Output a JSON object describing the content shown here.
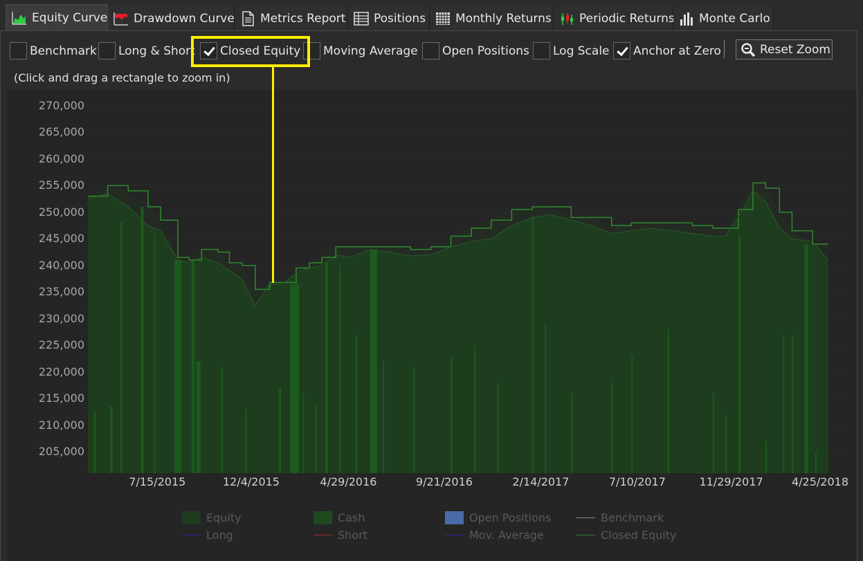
{
  "tabs": [
    {
      "label": "Equity Curve",
      "icon": "area-chart-icon",
      "active": true
    },
    {
      "label": "Drawdown Curve",
      "icon": "drawdown-chart-icon",
      "active": false
    },
    {
      "label": "Metrics Report",
      "icon": "document-icon",
      "active": false
    },
    {
      "label": "Positions",
      "icon": "table-icon",
      "active": false
    },
    {
      "label": "Monthly Returns",
      "icon": "grid-icon",
      "active": false
    },
    {
      "label": "Periodic Returns",
      "icon": "candlestick-icon",
      "active": false
    },
    {
      "label": "Monte Carlo",
      "icon": "histogram-icon",
      "active": false
    }
  ],
  "options": [
    {
      "label": "Benchmark",
      "checked": false
    },
    {
      "label": "Long & Short",
      "checked": false
    },
    {
      "label": "Closed Equity",
      "checked": true
    },
    {
      "label": "Moving Average",
      "checked": false
    },
    {
      "label": "Open Positions",
      "checked": false
    },
    {
      "label": "Log Scale",
      "checked": false
    },
    {
      "label": "Anchor at Zero",
      "checked": true
    }
  ],
  "reset_zoom_label": "Reset Zoom",
  "hint": "(Click and drag a rectangle to zoom in)",
  "colors": {
    "highlight": "#ffee00",
    "equity_fill": "#1e4a1e",
    "cash_fill": "#1a5a1a",
    "closed_equity_line": "#2e8b2e",
    "open_positions": "#4a6aa8",
    "benchmark": "#d0d0d0",
    "long": "#1a1a8a",
    "short": "#8a1a1a"
  },
  "chart_data": {
    "type": "area",
    "x_ticks": [
      "7/15/2015",
      "12/4/2015",
      "4/29/2016",
      "9/21/2016",
      "2/14/2017",
      "7/10/2017",
      "11/29/2017",
      "4/25/2018"
    ],
    "y_ticks": [
      "270,000",
      "265,000",
      "260,000",
      "255,000",
      "250,000",
      "245,000",
      "240,000",
      "235,000",
      "230,000",
      "225,000",
      "220,000",
      "215,000",
      "210,000",
      "205,000"
    ],
    "ylim": [
      201000,
      271000
    ],
    "xlim": [
      "2015-04-01",
      "2018-04-25"
    ],
    "series": [
      {
        "name": "Equity",
        "x": [
          "2015-04-01",
          "2015-05-01",
          "2015-06-01",
          "2015-07-01",
          "2015-07-20",
          "2015-08-15",
          "2015-09-01",
          "2015-09-20",
          "2015-10-15",
          "2015-11-01",
          "2015-11-20",
          "2015-12-10",
          "2016-01-01",
          "2016-01-20",
          "2016-02-10",
          "2016-03-01",
          "2016-03-20",
          "2016-04-10",
          "2016-05-01",
          "2016-06-01",
          "2016-07-01",
          "2016-08-01",
          "2016-09-01",
          "2016-10-01",
          "2016-11-01",
          "2016-12-01",
          "2017-01-01",
          "2017-02-01",
          "2017-03-01",
          "2017-04-01",
          "2017-05-01",
          "2017-06-01",
          "2017-07-01",
          "2017-08-01",
          "2017-09-01",
          "2017-10-01",
          "2017-11-01",
          "2017-11-20",
          "2017-12-10",
          "2018-01-01",
          "2018-01-20",
          "2018-02-10",
          "2018-03-01",
          "2018-04-01",
          "2018-04-25"
        ],
        "values": [
          252500,
          253500,
          251000,
          247500,
          246500,
          241000,
          240500,
          241500,
          240500,
          239000,
          237500,
          232500,
          236500,
          236500,
          238500,
          239500,
          240000,
          242000,
          241500,
          243000,
          242500,
          241800,
          242000,
          243500,
          244500,
          245000,
          247500,
          249000,
          249500,
          248500,
          247500,
          246000,
          246500,
          247000,
          246500,
          246000,
          245500,
          245500,
          249000,
          254000,
          252000,
          247000,
          245000,
          244500,
          241000
        ]
      },
      {
        "name": "Closed Equity",
        "x": [
          "2015-04-01",
          "2015-05-01",
          "2015-06-01",
          "2015-07-01",
          "2015-07-20",
          "2015-08-15",
          "2015-09-01",
          "2015-09-20",
          "2015-10-15",
          "2015-11-01",
          "2015-11-20",
          "2015-12-10",
          "2016-01-01",
          "2016-01-20",
          "2016-02-10",
          "2016-03-01",
          "2016-03-20",
          "2016-04-10",
          "2016-05-01",
          "2016-06-01",
          "2016-07-01",
          "2016-08-01",
          "2016-09-01",
          "2016-10-01",
          "2016-11-01",
          "2016-12-01",
          "2017-01-01",
          "2017-02-01",
          "2017-03-01",
          "2017-04-01",
          "2017-05-01",
          "2017-06-01",
          "2017-07-01",
          "2017-08-01",
          "2017-09-01",
          "2017-10-01",
          "2017-11-01",
          "2017-11-20",
          "2017-12-10",
          "2018-01-01",
          "2018-01-20",
          "2018-02-10",
          "2018-03-01",
          "2018-04-01",
          "2018-04-25"
        ],
        "values": [
          253000,
          255000,
          254000,
          251000,
          248500,
          241500,
          241000,
          243000,
          242500,
          240500,
          240000,
          235500,
          236800,
          236800,
          239500,
          240500,
          241500,
          243500,
          243500,
          243500,
          243500,
          243000,
          243500,
          245500,
          247000,
          248500,
          250500,
          251000,
          251000,
          249000,
          249000,
          247500,
          248000,
          248000,
          248000,
          247500,
          247000,
          247000,
          250500,
          255500,
          254500,
          250000,
          246500,
          244000,
          244000
        ]
      }
    ],
    "legend": [
      "Equity",
      "Cash",
      "Open Positions",
      "Benchmark",
      "Long",
      "Short",
      "Mov. Average",
      "Closed Equity"
    ],
    "legend_placement": "bottom",
    "grid": true
  }
}
